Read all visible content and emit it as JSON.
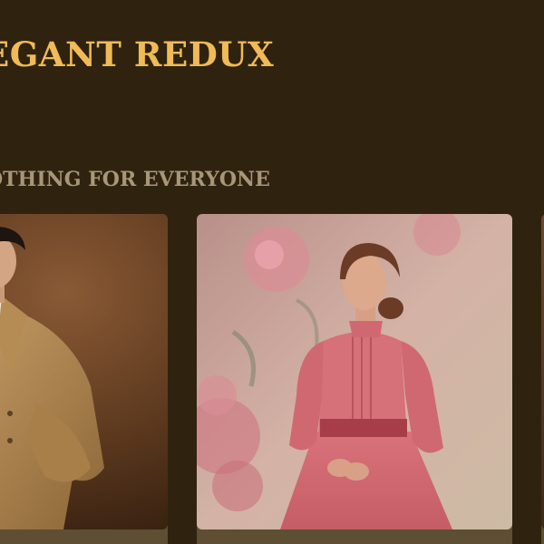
{
  "header": {
    "brand": "EGANT REDUX"
  },
  "hero": {
    "tagline": "OTHING FOR EVERYONE"
  },
  "colors": {
    "background": "#2f230f",
    "brand_text": "#f0ba58",
    "tagline_text": "#a79678",
    "card_footer": "#5d4e34"
  },
  "products": [
    {
      "image": "man-in-trench-coat-photo"
    },
    {
      "image": "woman-in-pink-dress-photo"
    },
    {
      "image": "partial-product-photo"
    }
  ]
}
